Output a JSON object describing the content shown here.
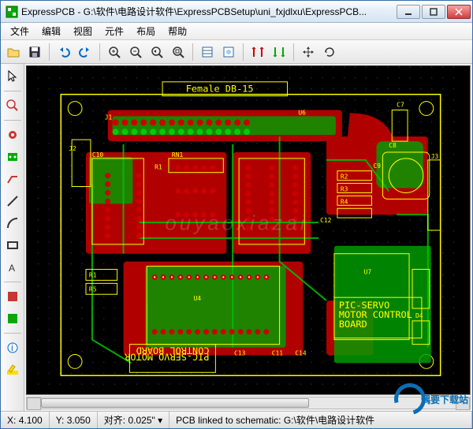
{
  "window": {
    "title": "ExpressPCB - G:\\软件\\电路设计软件\\ExpressPCBSetup\\uni_fxjdlxu\\ExpressPCB..."
  },
  "menubar": {
    "items": [
      "文件",
      "编辑",
      "视图",
      "元件",
      "布局",
      "帮助"
    ]
  },
  "toolbar": {
    "items": [
      "open",
      "save",
      "__sep",
      "undo",
      "redo",
      "__sep",
      "zoom-in",
      "zoom-out",
      "zoom-prev",
      "zoom-fit",
      "__sep",
      "properties",
      "options",
      "__sep",
      "flip-h",
      "flip-v",
      "__sep",
      "move",
      "rotate"
    ]
  },
  "lefttool": {
    "items": [
      "pointer",
      "__sep",
      "zoom-area",
      "__sep",
      "pad-round",
      "pad-square",
      "trace",
      "line",
      "arc",
      "rect",
      "text",
      "__sep",
      "component-red",
      "component-green",
      "__sep",
      "layer-top",
      "layer-bottom"
    ]
  },
  "pcb": {
    "title_top": "Female DB-15",
    "silk_text1": "PIC-SERVO MOTOR CONTROL BOARD",
    "silk_text2": "PIC-SERVO MOTOR CONTROL BOARD",
    "refs": [
      "J1",
      "J2",
      "J3",
      "C7",
      "C8",
      "C9",
      "C10",
      "C11",
      "C12",
      "C13",
      "C14",
      "RN1",
      "R1",
      "R2",
      "R3",
      "R4",
      "R5",
      "U4",
      "U6",
      "U7",
      "D4"
    ]
  },
  "status": {
    "x_label": "X:",
    "x_val": "4.100",
    "y_label": "Y:",
    "y_val": "3.050",
    "snap_label": "对齐:",
    "snap_val": "0.025\"",
    "link_label": "PCB linked to schematic: G:\\软件\\电路设计软件"
  },
  "watermark": "偶要下载站",
  "watermark_faint": "ouyaoxiazai"
}
